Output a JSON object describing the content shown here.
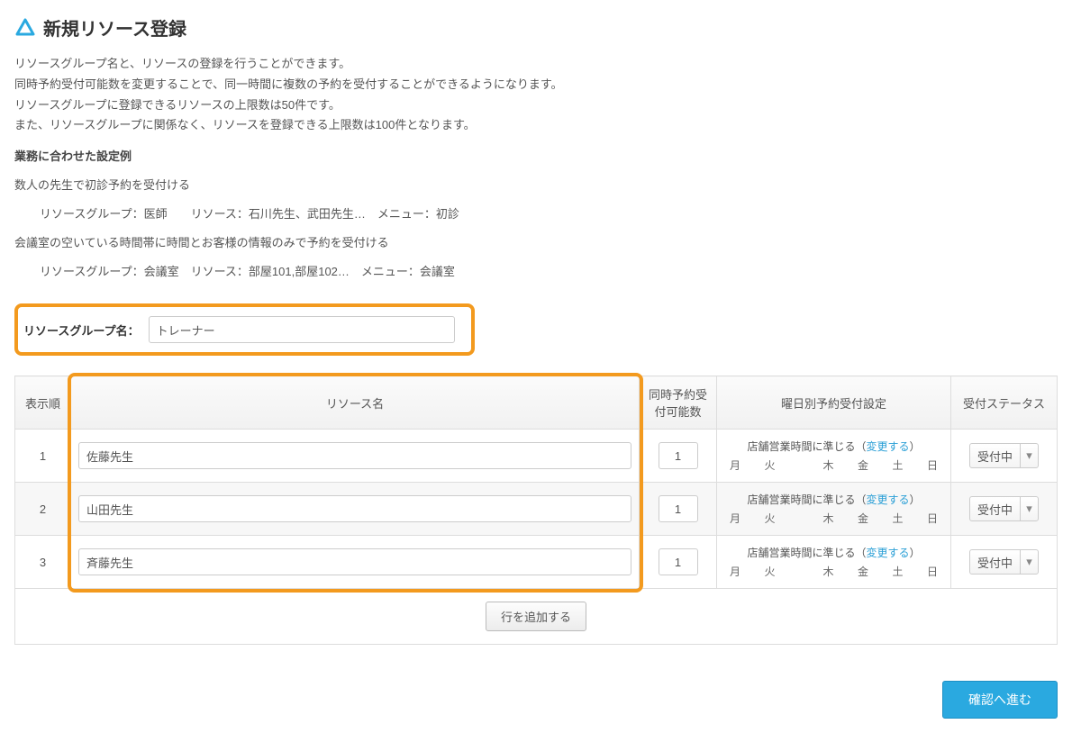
{
  "header": {
    "title": "新規リソース登録"
  },
  "description": {
    "l1": "リソースグループ名と、リソースの登録を行うことができます。",
    "l2": "同時予約受付可能数を変更することで、同一時間に複数の予約を受付することができるようになります。",
    "l3": "リソースグループに登録できるリソースの上限数は50件です。",
    "l4": "また、リソースグループに関係なく、リソースを登録できる上限数は100件となります。"
  },
  "examples": {
    "title": "業務に合わせた設定例",
    "a1": "数人の先生で初診予約を受付ける",
    "a2": "リソースグループ：医師　　リソース：石川先生、武田先生…　メニュー：初診",
    "b1": "会議室の空いている時間帯に時間とお客様の情報のみで予約を受付ける",
    "b2": "リソースグループ：会議室　リソース：部屋101,部屋102…　メニュー：会議室"
  },
  "group_name": {
    "label": "リソースグループ名：",
    "value": "トレーナー"
  },
  "table": {
    "headers": {
      "order": "表示順",
      "name": "リソース名",
      "count": "同時予約受付可能数",
      "days": "曜日別予約受付設定",
      "status": "受付ステータス"
    },
    "day_row_prefix": "店舗営業時間に準じる（",
    "day_row_link": "変更する",
    "day_row_suffix": "）",
    "days_labels": [
      "月",
      "火",
      "",
      "木",
      "金",
      "土",
      "日"
    ],
    "add_row_label": "行を追加する",
    "rows": [
      {
        "order": "1",
        "name": "佐藤先生",
        "count": "1",
        "status": "受付中"
      },
      {
        "order": "2",
        "name": "山田先生",
        "count": "1",
        "status": "受付中"
      },
      {
        "order": "3",
        "name": "斉藤先生",
        "count": "1",
        "status": "受付中"
      }
    ]
  },
  "footer": {
    "submit_label": "確認へ進む"
  }
}
